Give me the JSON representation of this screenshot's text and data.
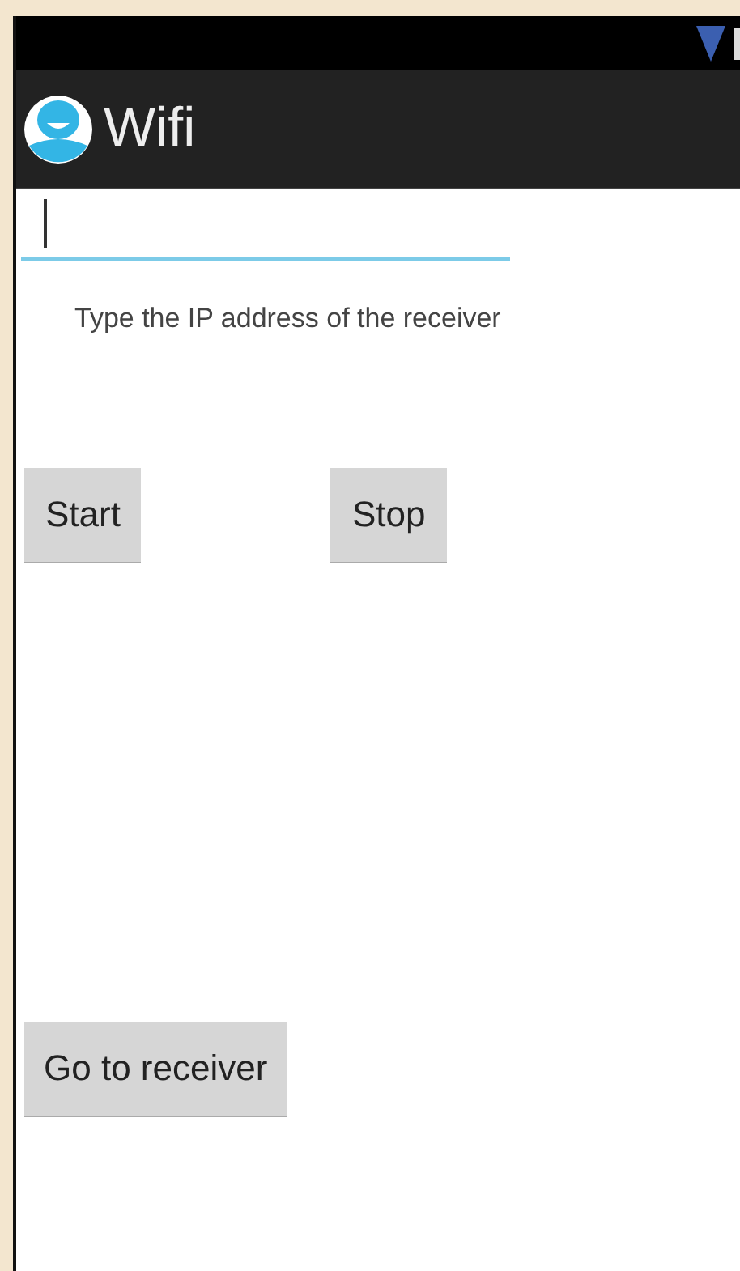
{
  "action_bar": {
    "title": "Wifi"
  },
  "ip_field": {
    "focused": true
  },
  "hint": "Type the IP address of the receiver",
  "buttons": [
    {
      "label": "Start"
    },
    {
      "label": "Stop"
    }
  ],
  "receiver_button": {
    "label": "Go to receiver"
  }
}
